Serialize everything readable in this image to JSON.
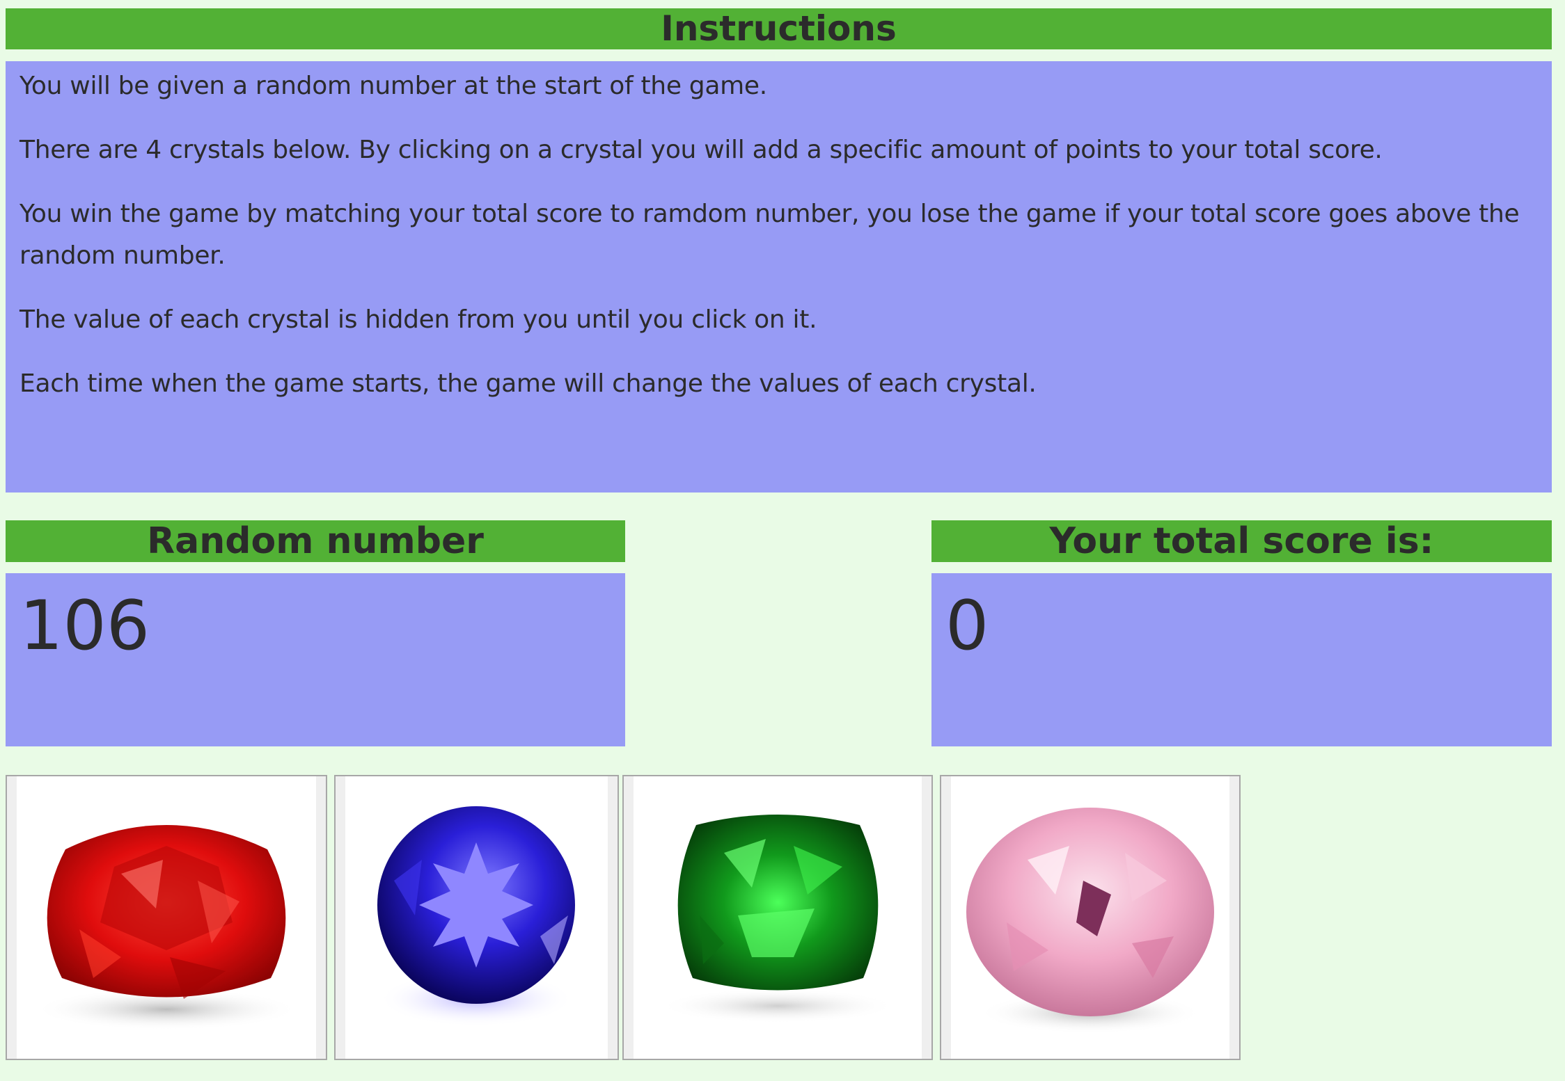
{
  "instructions": {
    "title": "Instructions",
    "paragraphs": [
      "You will be given a random number at the start of the game.",
      "There are 4 crystals below. By clicking on a crystal you will add a specific amount of points to your total score.",
      "You win the game by matching your total score to ramdom number, you lose the game if your total score goes above the random number.",
      "The value of each crystal is hidden from you until you click on it.",
      "Each time when the game starts, the game will change the values of each crystal."
    ]
  },
  "random_number": {
    "title": "Random number",
    "value": "106"
  },
  "total_score": {
    "title": "Your total score is:",
    "value": "0"
  },
  "crystals": [
    {
      "name": "red-crystal-icon",
      "color": "#e00d0d"
    },
    {
      "name": "blue-crystal-icon",
      "color": "#2a1fd8"
    },
    {
      "name": "green-crystal-icon",
      "color": "#119a1c"
    },
    {
      "name": "pink-crystal-icon",
      "color": "#f1a9c7"
    }
  ],
  "colors": {
    "background": "#e9fbe6",
    "header_bar": "#52b135",
    "panel": "#979bf5"
  }
}
